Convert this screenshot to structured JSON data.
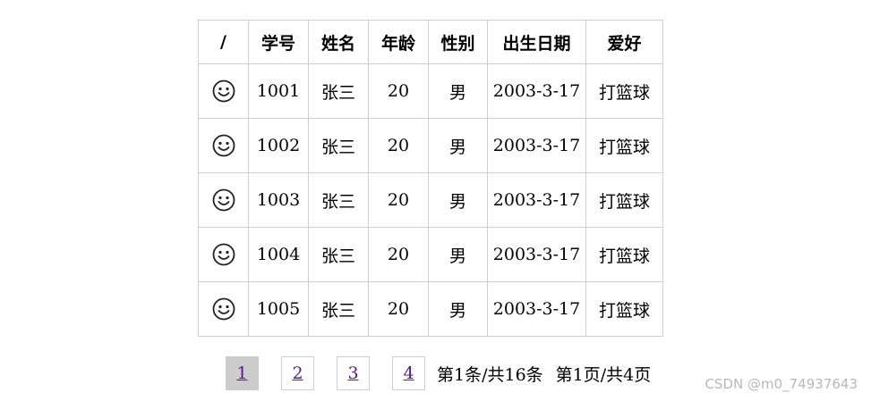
{
  "table": {
    "headers": [
      "/",
      "学号",
      "姓名",
      "年龄",
      "性别",
      "出生日期",
      "爱好"
    ],
    "row_icon": "smiley-face-icon",
    "rows": [
      {
        "id": "1001",
        "name": "张三",
        "age": "20",
        "gender": "男",
        "birth": "2003-3-17",
        "hobby": "打篮球"
      },
      {
        "id": "1002",
        "name": "张三",
        "age": "20",
        "gender": "男",
        "birth": "2003-3-17",
        "hobby": "打篮球"
      },
      {
        "id": "1003",
        "name": "张三",
        "age": "20",
        "gender": "男",
        "birth": "2003-3-17",
        "hobby": "打篮球"
      },
      {
        "id": "1004",
        "name": "张三",
        "age": "20",
        "gender": "男",
        "birth": "2003-3-17",
        "hobby": "打篮球"
      },
      {
        "id": "1005",
        "name": "张三",
        "age": "20",
        "gender": "男",
        "birth": "2003-3-17",
        "hobby": "打篮球"
      }
    ]
  },
  "pagination": {
    "pages": [
      "1",
      "2",
      "3",
      "4"
    ],
    "current_page": "1",
    "record_info": "第1条/共16条",
    "page_info": "第1页/共4页"
  },
  "watermark": "CSDN @m0_74937643",
  "colors": {
    "border": "#cfcfcf",
    "current_page_bg": "#cccccc",
    "link": "#551a8b",
    "watermark": "#b8b8b8"
  }
}
